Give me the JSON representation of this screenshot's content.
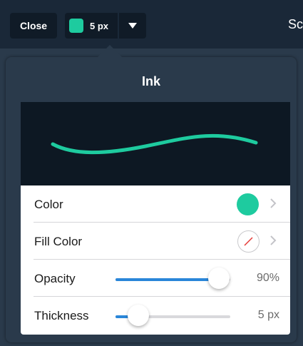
{
  "toolbar": {
    "close_label": "Close",
    "ink_size_label": "5 px",
    "ink_color": "#1ecb9f",
    "right_text": "Sc"
  },
  "popover": {
    "title": "Ink",
    "stroke_color": "#1ecb9f",
    "rows": {
      "color": {
        "label": "Color",
        "value_color": "#1ecb9f"
      },
      "fill_color": {
        "label": "Fill Color",
        "value": "none"
      },
      "opacity": {
        "label": "Opacity",
        "value": "90%",
        "level": 0.9
      },
      "thickness": {
        "label": "Thickness",
        "value": "5 px",
        "level": 0.2
      }
    }
  },
  "icons": {
    "dropdown": "triangle-down-icon",
    "chevron": "chevron-right-icon",
    "no_fill": "no-fill-icon"
  }
}
